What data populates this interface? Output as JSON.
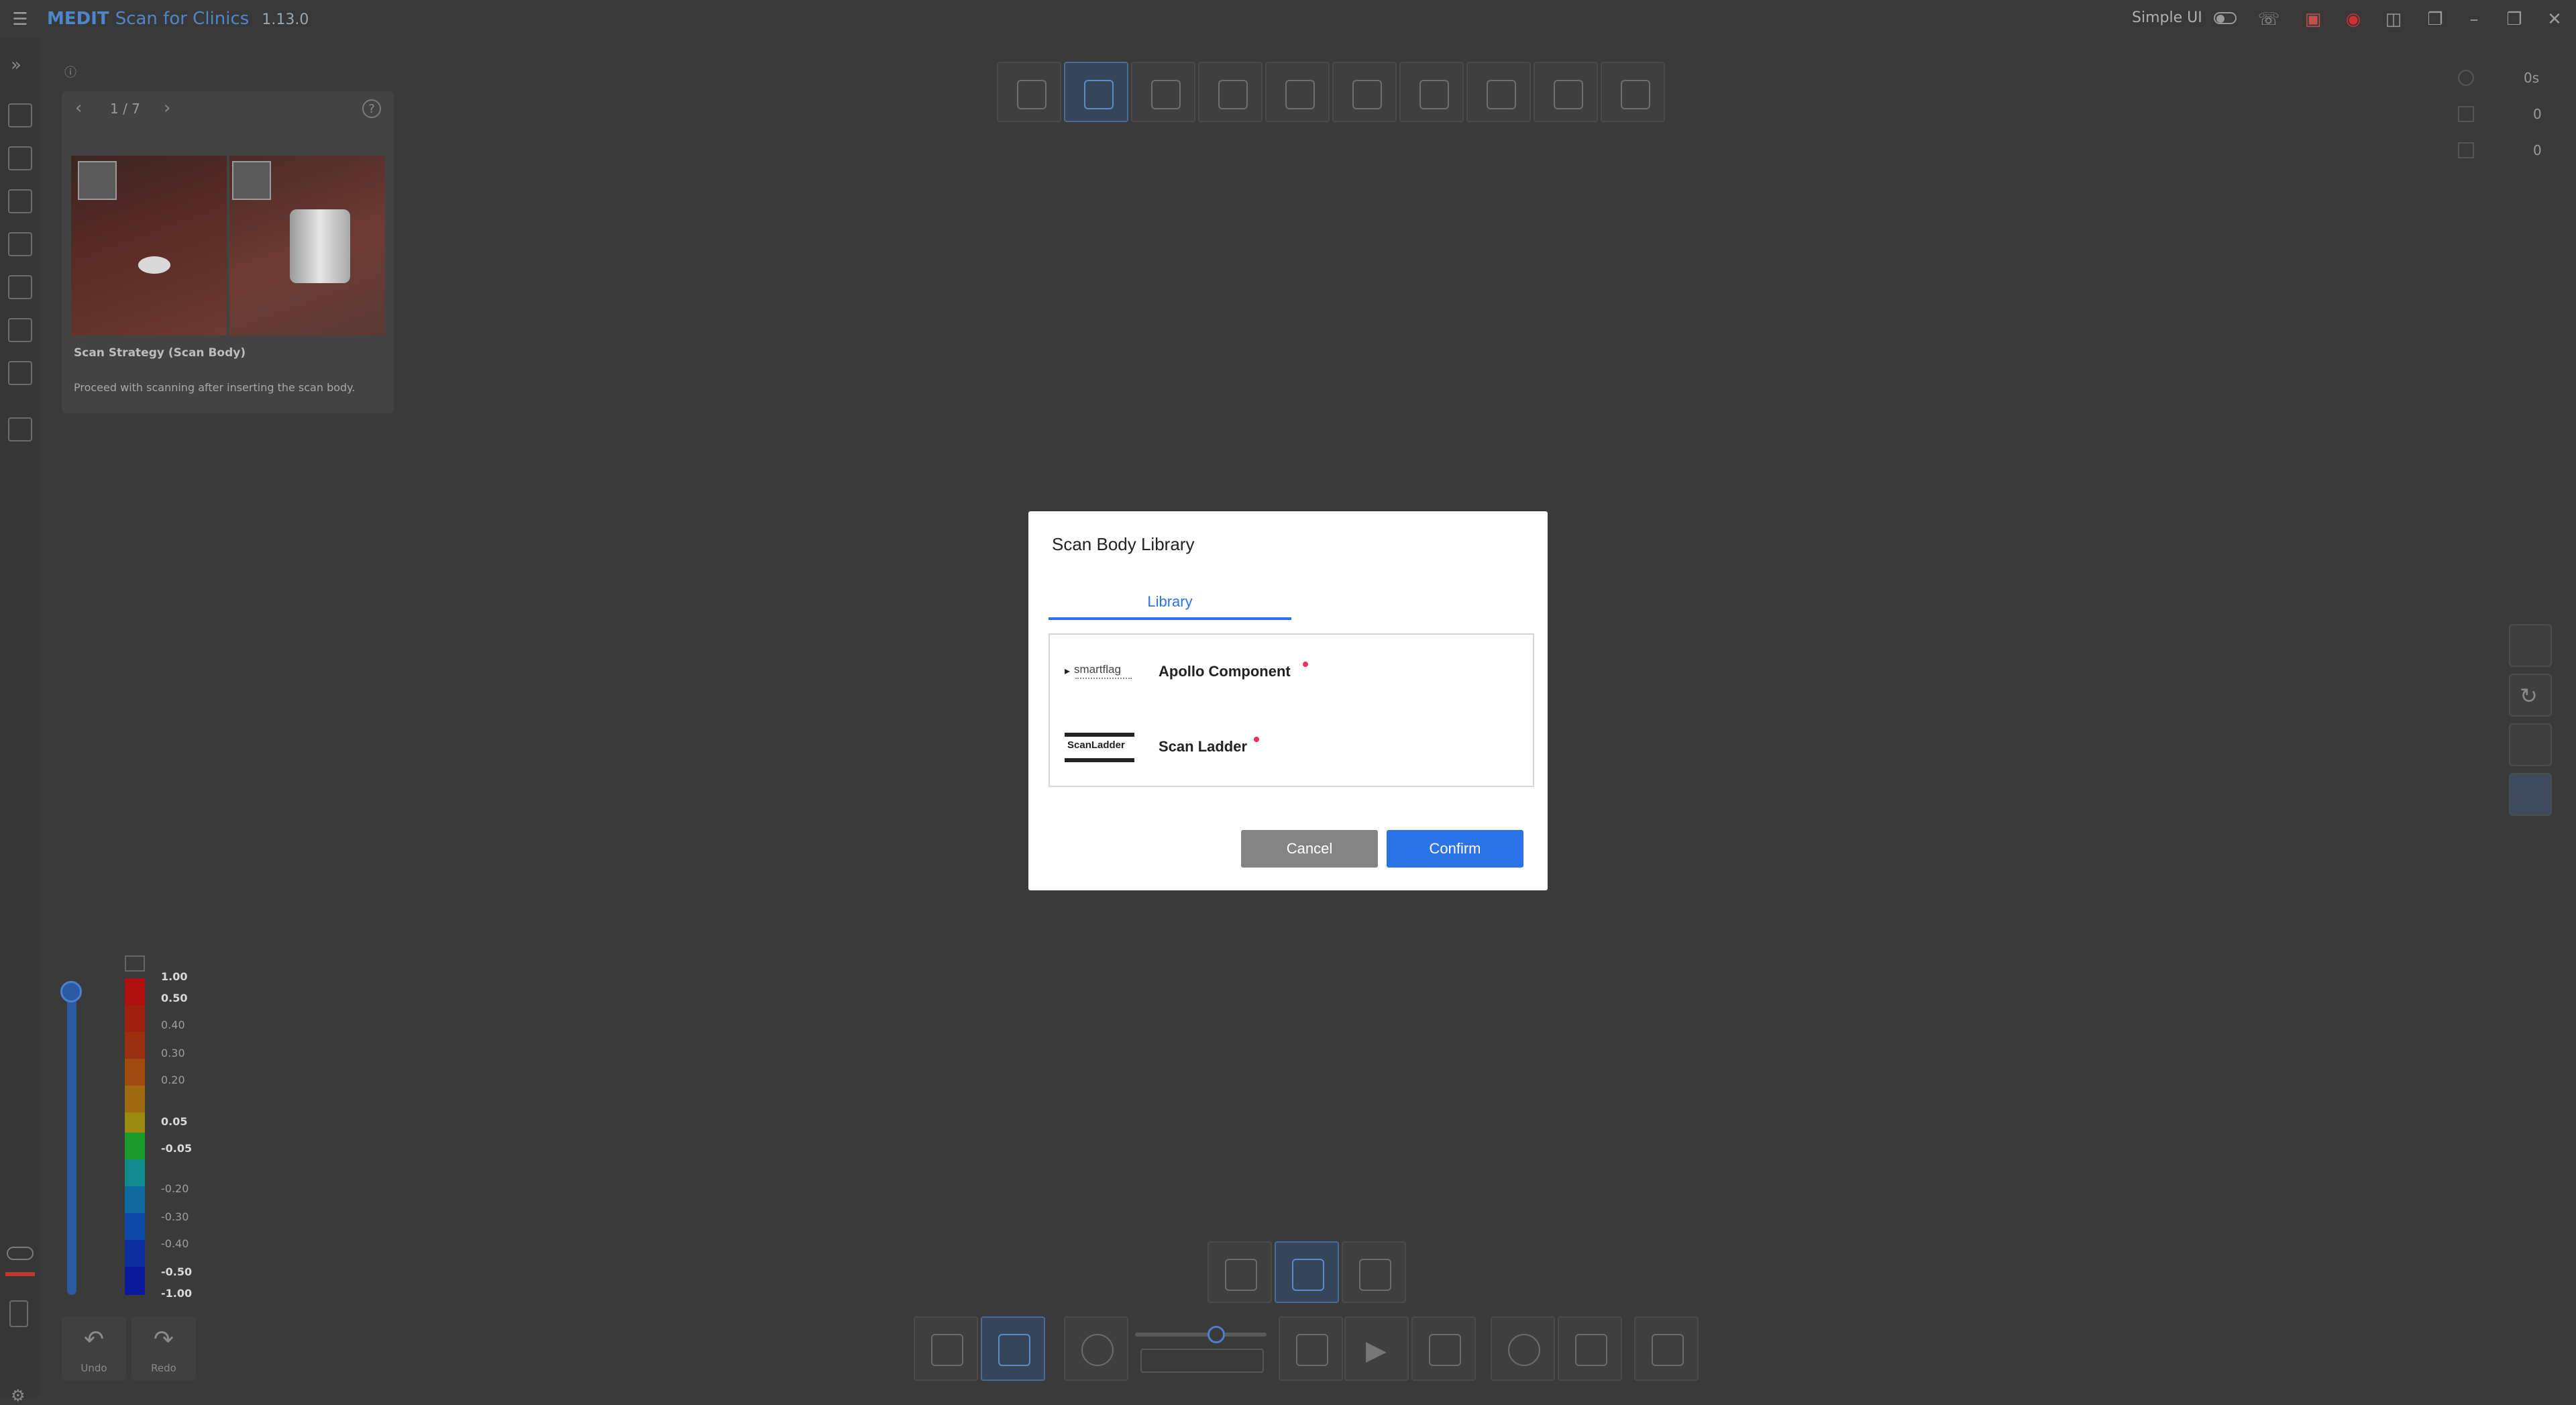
{
  "app": {
    "brand": "MEDIT",
    "title_rest": "Scan for Clinics",
    "version": "1.13.0",
    "simple_ui_label": "Simple UI"
  },
  "guide": {
    "page": "1 / 7",
    "title": "Scan Strategy (Scan Body)",
    "description": "Proceed with scanning after inserting the scan body."
  },
  "stats": {
    "time": "0s",
    "count1": "0",
    "count2": "0"
  },
  "scale": {
    "labels": [
      "1.00",
      "0.50",
      "0.40",
      "0.30",
      "0.20",
      "0.05",
      "-0.05",
      "-0.20",
      "-0.30",
      "-0.40",
      "-0.50",
      "-1.00"
    ]
  },
  "undo": {
    "label": "Undo"
  },
  "redo": {
    "label": "Redo"
  },
  "modal": {
    "title": "Scan Body Library",
    "tab": "Library",
    "items": [
      {
        "name": "Apollo Component",
        "logo": "smartflag"
      },
      {
        "name": "Scan Ladder",
        "logo": "ScanLadder"
      }
    ],
    "cancel": "Cancel",
    "confirm": "Confirm"
  },
  "colors": {
    "accent": "#2b73e6",
    "dot": "#e8305e",
    "cancel": "#848484"
  }
}
